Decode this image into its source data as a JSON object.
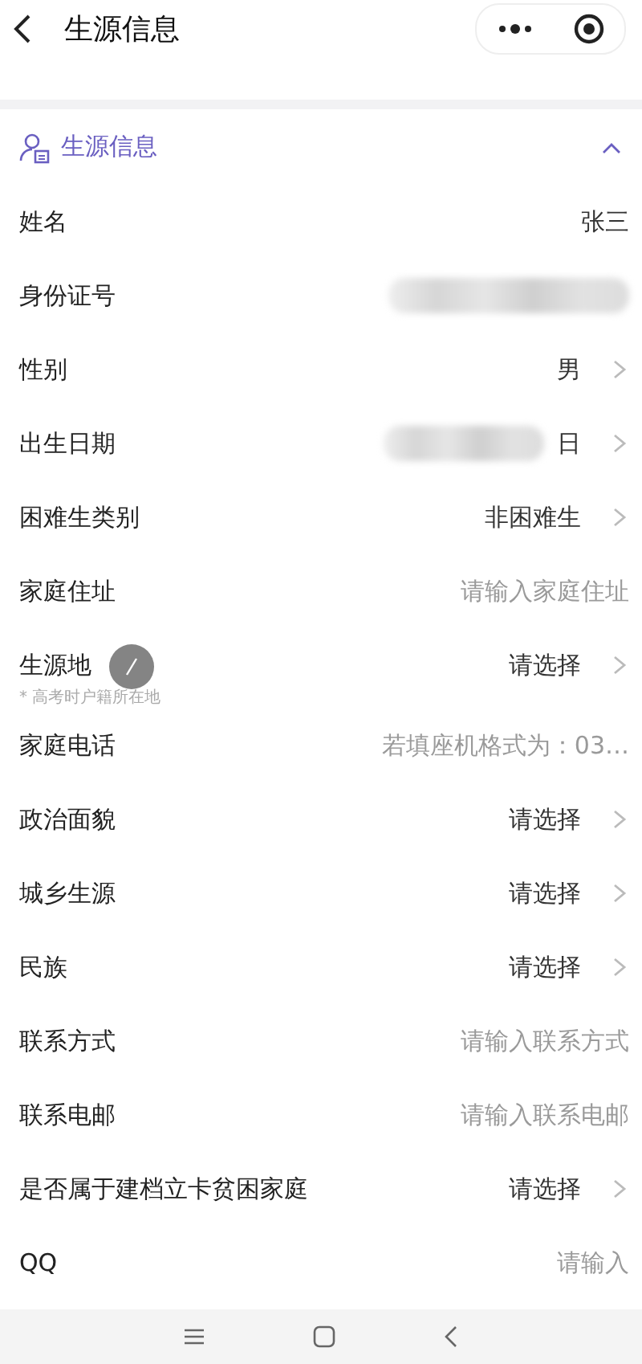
{
  "header": {
    "title": "生源信息"
  },
  "section": {
    "title": "生源信息",
    "expanded": true
  },
  "rows": [
    {
      "label": "姓名",
      "kind": "value",
      "value": "张三",
      "chevron": false
    },
    {
      "label": "身份证号",
      "kind": "masked",
      "chevron": false
    },
    {
      "label": "性别",
      "kind": "value",
      "value": "男",
      "chevron": true
    },
    {
      "label": "出生日期",
      "kind": "masked",
      "value": "日",
      "chevron": true
    },
    {
      "label": "困难生类别",
      "kind": "value",
      "value": "非困难生",
      "chevron": true
    },
    {
      "label": "家庭住址",
      "kind": "placeholder",
      "placeholder": "请输入家庭住址",
      "chevron": false
    },
    {
      "label": "生源地",
      "kind": "value",
      "value": "请选择",
      "chevron": true,
      "hint": "* 高考时户籍所在地"
    },
    {
      "label": "家庭电话",
      "kind": "placeholder",
      "placeholder": "若填座机格式为：03…",
      "chevron": false
    },
    {
      "label": "政治面貌",
      "kind": "value",
      "value": "请选择",
      "chevron": true
    },
    {
      "label": "城乡生源",
      "kind": "value",
      "value": "请选择",
      "chevron": true
    },
    {
      "label": "民族",
      "kind": "value",
      "value": "请选择",
      "chevron": true
    },
    {
      "label": "联系方式",
      "kind": "placeholder",
      "placeholder": "请输入联系方式",
      "chevron": false
    },
    {
      "label": "联系电邮",
      "kind": "placeholder",
      "placeholder": "请输入联系电邮",
      "chevron": false
    },
    {
      "label": "是否属于建档立卡贫困家庭",
      "kind": "value",
      "value": "请选择",
      "chevron": true
    },
    {
      "label": "QQ",
      "kind": "placeholder",
      "placeholder": "请输入",
      "chevron": false
    }
  ]
}
